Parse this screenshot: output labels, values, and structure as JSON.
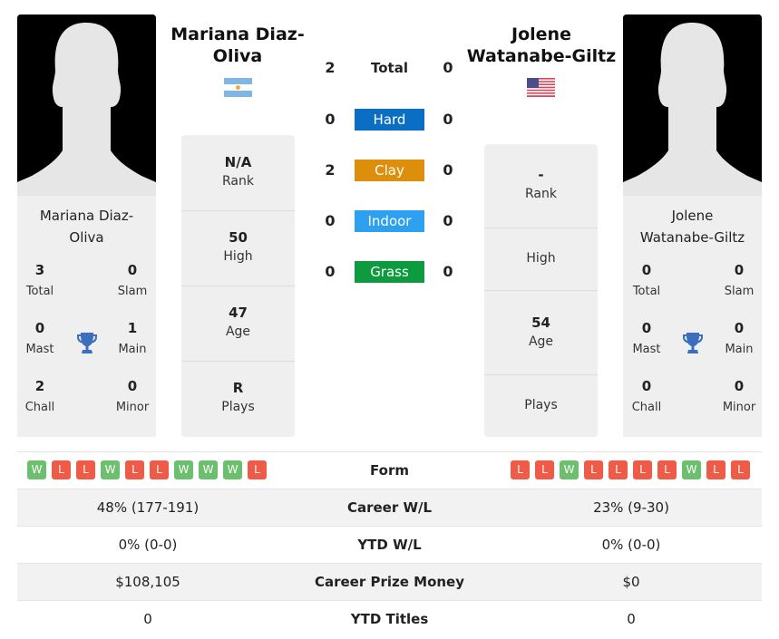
{
  "player1": {
    "name": "Mariana Diaz-Oliva",
    "heading_line1": "Mariana Diaz-",
    "heading_line2": "Oliva",
    "card_name_line1": "Mariana Diaz-",
    "card_name_line2": "Oliva",
    "flag": "argentina-flag",
    "titles": {
      "total": {
        "value": "3",
        "label": "Total"
      },
      "slam": {
        "value": "0",
        "label": "Slam"
      },
      "mast": {
        "value": "0",
        "label": "Mast"
      },
      "main": {
        "value": "1",
        "label": "Main"
      },
      "chall": {
        "value": "2",
        "label": "Chall"
      },
      "minor": {
        "value": "0",
        "label": "Minor"
      }
    },
    "stats": {
      "rank": {
        "value": "N/A",
        "label": "Rank"
      },
      "high": {
        "value": "50",
        "label": "High"
      },
      "age": {
        "value": "47",
        "label": "Age"
      },
      "plays": {
        "value": "R",
        "label": "Plays"
      }
    },
    "form": [
      "W",
      "L",
      "L",
      "W",
      "L",
      "L",
      "W",
      "W",
      "W",
      "L"
    ],
    "career_wl": "48% (177-191)",
    "ytd_wl": "0% (0-0)",
    "career_prize_money": "$108,105",
    "ytd_titles": "0"
  },
  "player2": {
    "name": "Jolene Watanabe-Giltz",
    "heading_line1": "Jolene",
    "heading_line2": "Watanabe-Giltz",
    "card_name_line1": "Jolene",
    "card_name_line2": "Watanabe-Giltz",
    "flag": "usa-flag",
    "titles": {
      "total": {
        "value": "0",
        "label": "Total"
      },
      "slam": {
        "value": "0",
        "label": "Slam"
      },
      "mast": {
        "value": "0",
        "label": "Mast"
      },
      "main": {
        "value": "0",
        "label": "Main"
      },
      "chall": {
        "value": "0",
        "label": "Chall"
      },
      "minor": {
        "value": "0",
        "label": "Minor"
      }
    },
    "stats": {
      "rank": {
        "value": "-",
        "label": "Rank"
      },
      "high": {
        "value": "",
        "label": "High"
      },
      "age": {
        "value": "54",
        "label": "Age"
      },
      "plays": {
        "value": "",
        "label": "Plays"
      }
    },
    "form": [
      "L",
      "L",
      "W",
      "L",
      "L",
      "L",
      "L",
      "W",
      "L",
      "L"
    ],
    "career_wl": "23% (9-30)",
    "ytd_wl": "0% (0-0)",
    "career_prize_money": "$0",
    "ytd_titles": "0"
  },
  "h2h": [
    {
      "label": "Total",
      "p1": "2",
      "p2": "0",
      "color": ""
    },
    {
      "label": "Hard",
      "p1": "0",
      "p2": "0",
      "color": "#0a6ec4"
    },
    {
      "label": "Clay",
      "p1": "2",
      "p2": "0",
      "color": "#dd8e0a"
    },
    {
      "label": "Indoor",
      "p1": "0",
      "p2": "0",
      "color": "#2da1f0"
    },
    {
      "label": "Grass",
      "p1": "0",
      "p2": "0",
      "color": "#0e9a3e"
    }
  ],
  "table_labels": {
    "form": "Form",
    "career_wl": "Career W/L",
    "ytd_wl": "YTD W/L",
    "career_prize_money": "Career Prize Money",
    "ytd_titles": "YTD Titles"
  }
}
